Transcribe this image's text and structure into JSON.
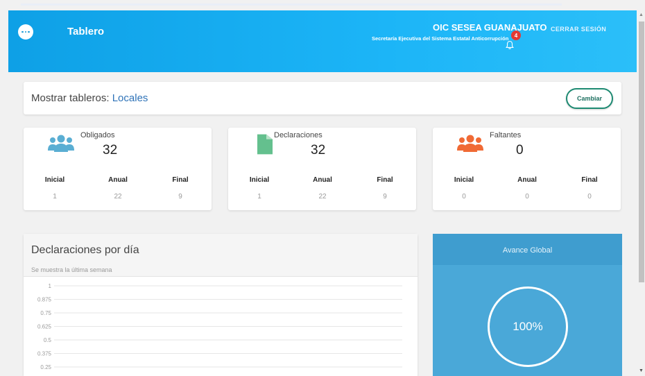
{
  "header": {
    "title": "Tablero",
    "org_name": "OIC SESEA GUANAJUATO",
    "org_subtitle": "Secretaría Ejecutiva del Sistema Estatal Anticorrupción",
    "logout_label": "CERRAR SESIÓN",
    "notification_count": "4",
    "colors": {
      "gradient_start": "#0ea0e6",
      "gradient_end": "#2bbff9",
      "badge": "#e53935"
    }
  },
  "board_selector": {
    "label": "Mostrar tableros:",
    "value": "Locales",
    "button_label": "Cambiar"
  },
  "stats": [
    {
      "label": "Obligados",
      "value": "32",
      "icon": "users-icon",
      "color": "#5aaed3",
      "cols": [
        {
          "h": "Inicial",
          "v": "1"
        },
        {
          "h": "Anual",
          "v": "22"
        },
        {
          "h": "Final",
          "v": "9"
        }
      ]
    },
    {
      "label": "Declaraciones",
      "value": "32",
      "icon": "document-icon",
      "color": "#64c08e",
      "cols": [
        {
          "h": "Inicial",
          "v": "1"
        },
        {
          "h": "Anual",
          "v": "22"
        },
        {
          "h": "Final",
          "v": "9"
        }
      ]
    },
    {
      "label": "Faltantes",
      "value": "0",
      "icon": "users-icon",
      "color": "#f06a35",
      "cols": [
        {
          "h": "Inicial",
          "v": "0"
        },
        {
          "h": "Anual",
          "v": "0"
        },
        {
          "h": "Final",
          "v": "0"
        }
      ]
    }
  ],
  "declarations_chart": {
    "title": "Declaraciones por día",
    "subtitle": "Se muestra la última semana"
  },
  "chart_data": {
    "type": "line",
    "title": "Declaraciones por día",
    "subtitle": "Se muestra la última semana",
    "y_ticks": [
      "1",
      "0.875",
      "0.75",
      "0.625",
      "0.5",
      "0.375",
      "0.25"
    ],
    "ylim": [
      0.25,
      1
    ],
    "grid": true,
    "series": []
  },
  "global_progress": {
    "title": "Avance Global",
    "value": "100%",
    "percent": 100
  }
}
